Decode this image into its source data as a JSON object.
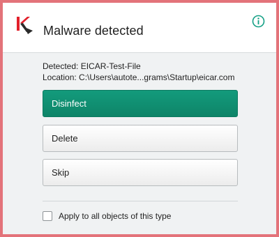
{
  "header": {
    "title": "Malware detected",
    "logo_icon": "kaspersky-k-logo",
    "info_icon": "info-circle-icon"
  },
  "details": {
    "detected": "Detected: EICAR-Test-File",
    "location": "Location:  C:\\Users\\autote...grams\\Startup\\eicar.com"
  },
  "actions": {
    "disinfect": "Disinfect",
    "delete": "Delete",
    "skip": "Skip"
  },
  "apply_all": {
    "label": "Apply to all objects of this type",
    "checked": false
  },
  "colors": {
    "frame_border": "#e3737a",
    "primary_button": "#0e8468",
    "info_icon": "#14a085",
    "logo_red": "#e2202b"
  }
}
